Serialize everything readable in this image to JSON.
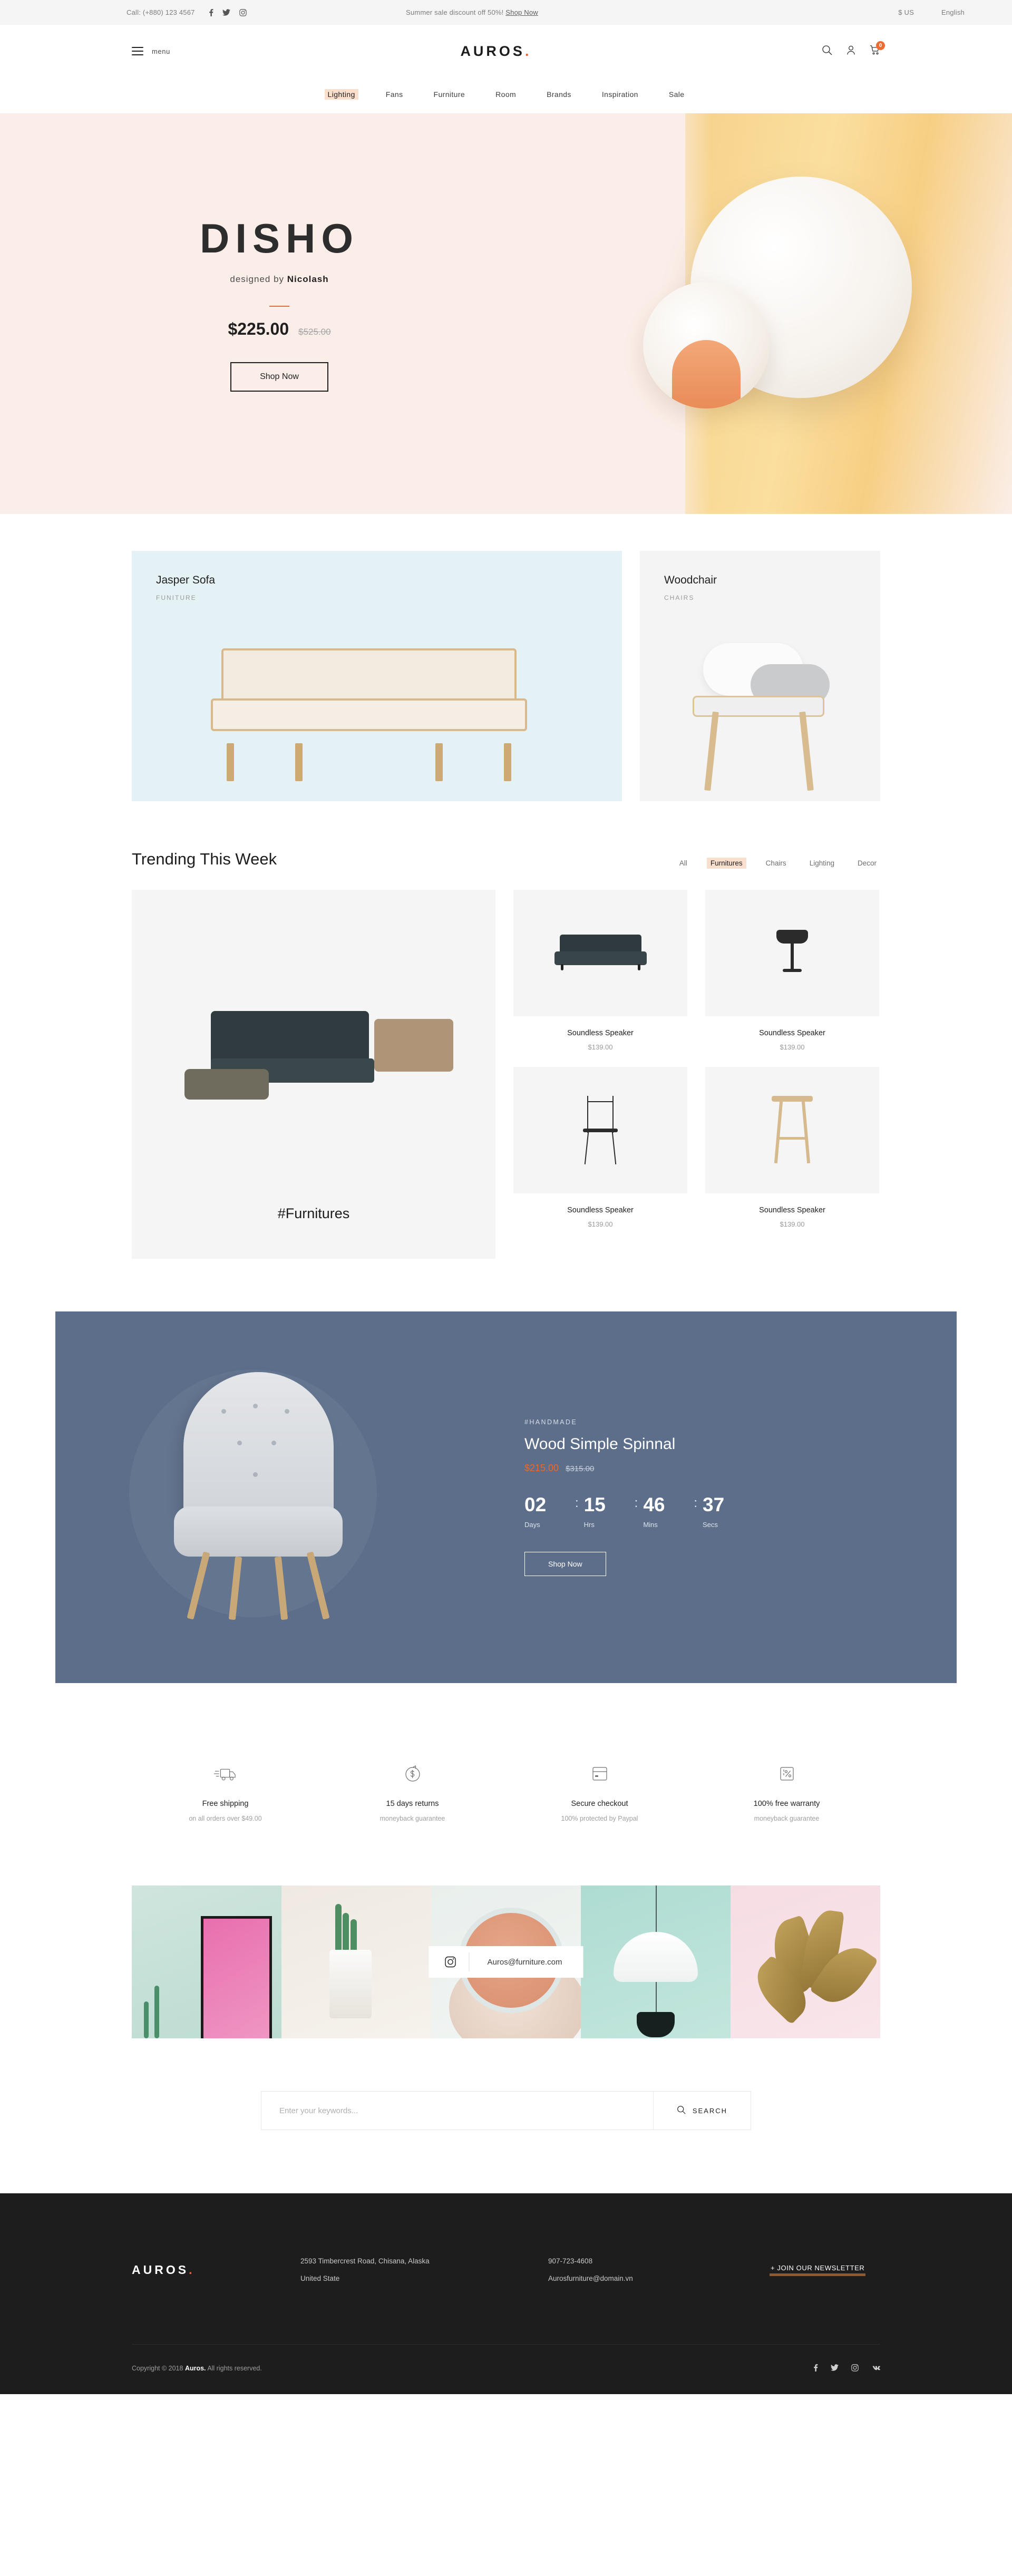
{
  "topbar": {
    "call": "Call: (+880) 123 4567",
    "socials": [
      "facebook-icon",
      "twitter-icon",
      "instagram-icon"
    ],
    "promo_text": "Summer sale discount off 50%!",
    "promo_link": "Shop Now",
    "currency": "$ US",
    "language": "English"
  },
  "header": {
    "menu_label": "menu",
    "brand": "AUROS",
    "brand_dot": ".",
    "icons": [
      "search-icon",
      "account-icon",
      "cart-icon"
    ],
    "cart_count": "0"
  },
  "nav": {
    "items": [
      {
        "label": "Lighting",
        "active": true
      },
      {
        "label": "Fans",
        "active": false
      },
      {
        "label": "Furniture",
        "active": false
      },
      {
        "label": "Room",
        "active": false
      },
      {
        "label": "Brands",
        "active": false
      },
      {
        "label": "Inspiration",
        "active": false
      },
      {
        "label": "Sale",
        "active": false
      }
    ]
  },
  "hero": {
    "title": "DISHO",
    "designed_prefix": "designed by ",
    "designer": "Nicolash",
    "price": "$225.00",
    "old_price": "$525.00",
    "cta": "Shop Now"
  },
  "categories": [
    {
      "name": "Jasper Sofa",
      "kind": "FUNITURE"
    },
    {
      "name": "Woodchair",
      "kind": "CHAIRS"
    }
  ],
  "trending": {
    "title": "Trending This Week",
    "filters": [
      {
        "label": "All",
        "active": false
      },
      {
        "label": "Furnitures",
        "active": true
      },
      {
        "label": "Chairs",
        "active": false
      },
      {
        "label": "Lighting",
        "active": false
      },
      {
        "label": "Decor",
        "active": false
      }
    ],
    "feature_tag": "#Furnitures",
    "products": [
      {
        "name": "Soundless Speaker",
        "price": "$139.00"
      },
      {
        "name": "Soundless Speaker",
        "price": "$139.00"
      },
      {
        "name": "Soundless Speaker",
        "price": "$139.00"
      },
      {
        "name": "Soundless Speaker",
        "price": "$139.00"
      }
    ]
  },
  "promo": {
    "tag": "#HANDMADE",
    "title": "Wood Simple Spinnal",
    "price": "$215.00",
    "old_price": "$315.00",
    "countdown": [
      {
        "value": "02",
        "label": "Days"
      },
      {
        "value": "15",
        "label": "Hrs"
      },
      {
        "value": "46",
        "label": "Mins"
      },
      {
        "value": "37",
        "label": "Secs"
      }
    ],
    "cta": "Shop Now",
    "bg_color": "#5c6e8a",
    "accent_color": "#f26522"
  },
  "features": [
    {
      "icon": "truck-icon",
      "title": "Free shipping",
      "sub": "on all orders over $49.00"
    },
    {
      "icon": "refund-icon",
      "title": "15 days returns",
      "sub": "moneyback guarantee"
    },
    {
      "icon": "card-icon",
      "title": "Secure checkout",
      "sub": "100% protected by Paypal"
    },
    {
      "icon": "percent-icon",
      "title": "100% free warranty",
      "sub": "moneyback guarantee"
    }
  ],
  "instagram": {
    "icon": "instagram-icon",
    "handle": "Auros@furniture.com"
  },
  "search": {
    "placeholder": "Enter your keywords...",
    "value": "",
    "button": "SEARCH",
    "icon": "search-icon"
  },
  "footer": {
    "brand": "AUROS",
    "brand_dot": ".",
    "address_line1": "2593 Timbercrest Road, Chisana, Alaska",
    "address_line2": "United State",
    "phone": "907-723-4608",
    "email": "Aurosfurniture@domain.vn",
    "newsletter": "+ JOIN OUR NEWSLETTER",
    "copyright_pre": "Copyright © 2018 ",
    "copyright_brand": "Auros.",
    "copyright_post": " All rights reserved.",
    "socials": [
      "facebook-icon",
      "twitter-icon",
      "instagram-icon",
      "vk-icon"
    ]
  }
}
